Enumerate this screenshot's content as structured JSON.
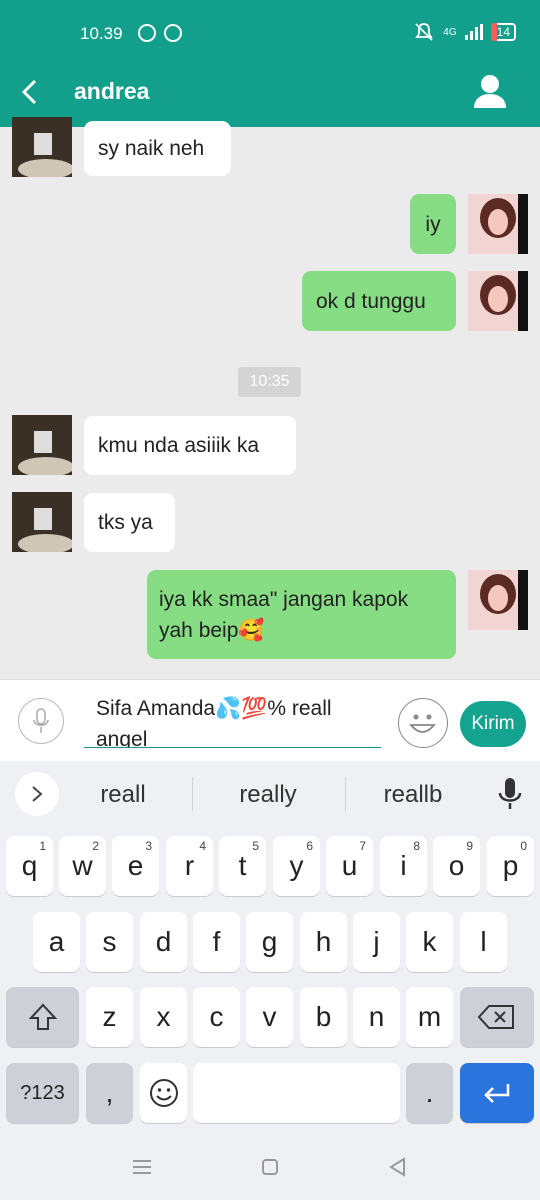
{
  "status_bar": {
    "time": "10.39",
    "network": "4G",
    "battery": "14"
  },
  "header": {
    "title": "andrea"
  },
  "messages": [
    {
      "text": "sy naik neh"
    },
    {
      "text": "iy"
    },
    {
      "text": "ok d tunggu"
    },
    {
      "text": "kmu nda asiiik ka"
    },
    {
      "text": "tks ya"
    },
    {
      "text": "iya kk smaa\" jangan kapok yah beip🥰"
    }
  ],
  "timestamp": "10:35",
  "composer": {
    "text": "Sifa Amanda💦💯% reall angel",
    "send_label": "Kirim"
  },
  "suggestions": [
    "reall",
    "really",
    "reallb"
  ],
  "keyboard": {
    "row1": [
      {
        "k": "q",
        "h": "1"
      },
      {
        "k": "w",
        "h": "2"
      },
      {
        "k": "e",
        "h": "3"
      },
      {
        "k": "r",
        "h": "4"
      },
      {
        "k": "t",
        "h": "5"
      },
      {
        "k": "y",
        "h": "6"
      },
      {
        "k": "u",
        "h": "7"
      },
      {
        "k": "i",
        "h": "8"
      },
      {
        "k": "o",
        "h": "9"
      },
      {
        "k": "p",
        "h": "0"
      }
    ],
    "row2": [
      "a",
      "s",
      "d",
      "f",
      "g",
      "h",
      "j",
      "k",
      "l"
    ],
    "row3": [
      "z",
      "x",
      "c",
      "v",
      "b",
      "n",
      "m"
    ],
    "symbols_label": "?123",
    "comma": ",",
    "period": "."
  },
  "colors": {
    "header": "#129f8c",
    "outgoing_bubble": "#86dd83",
    "send_button": "#13a38f",
    "enter_key": "#2a74de"
  }
}
